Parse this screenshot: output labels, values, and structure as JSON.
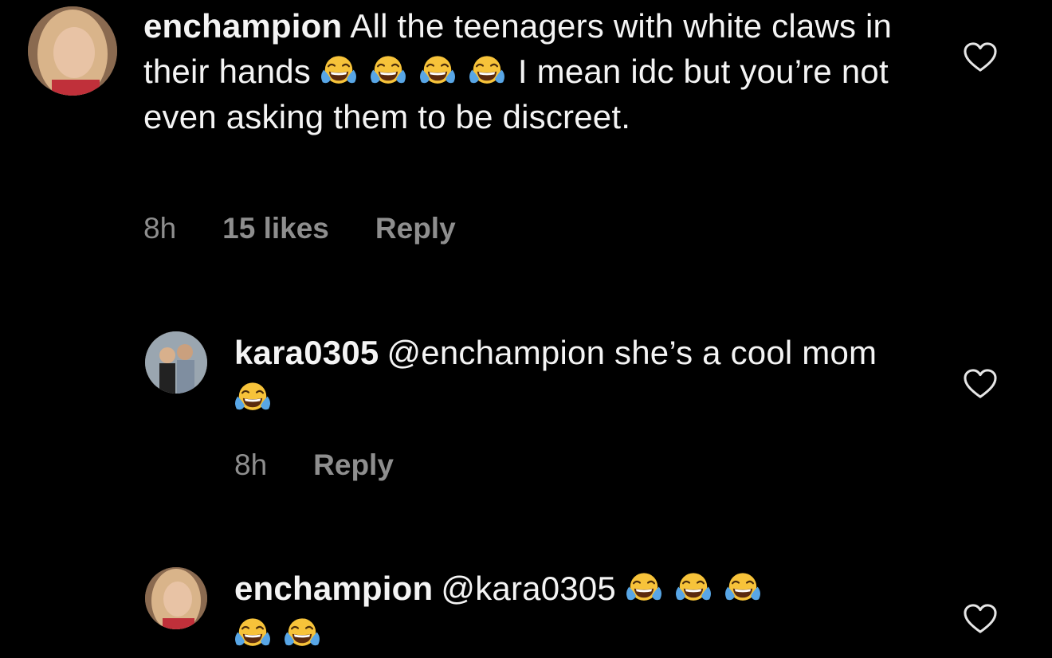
{
  "comments": [
    {
      "username": "enchampion",
      "text_part1": "All the teenagers with white claws in their hands",
      "text_part2": "I mean idc but you’re not even asking them to be discreet.",
      "emoji_count": 4,
      "emoji_icon": "face-with-tears-of-joy",
      "time": "8h",
      "likes": "15 likes",
      "reply_label": "Reply",
      "liked": false
    },
    {
      "username": "kara0305",
      "text_part1": "@enchampion she’s a cool mom",
      "emoji_count": 1,
      "emoji_icon": "face-with-tears-of-joy",
      "time": "8h",
      "reply_label": "Reply",
      "liked": false
    },
    {
      "username": "enchampion",
      "text_part1": "@kara0305",
      "emoji_count": 5,
      "emoji_icon": "face-with-tears-of-joy",
      "liked": false
    }
  ],
  "icons": {
    "like": "heart-outline-icon",
    "emoji": "face-with-tears-of-joy"
  },
  "colors": {
    "background": "#000000",
    "text": "#f4f4f4",
    "meta": "#8e8e8e"
  }
}
